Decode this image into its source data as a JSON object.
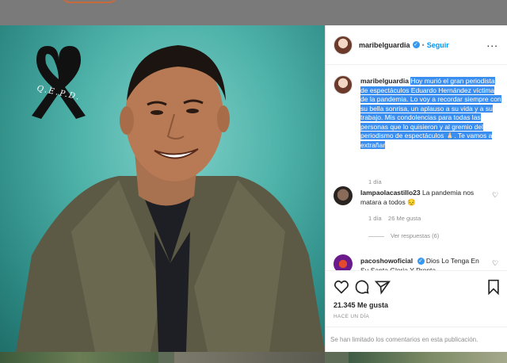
{
  "post": {
    "ribbon_text": "Q.E.P.D."
  },
  "header": {
    "username": "maribelguardia",
    "verified_icon": "check",
    "separator": "•",
    "follow_label": "Seguir",
    "more_label": "..."
  },
  "caption": {
    "username": "maribelguardia",
    "text": "Hoy murió el gran periodista de espectáculos Eduardo Hernández víctima de la pandemia. Lo voy a recordar siempre con su bella sonrisa, un aplauso a su vida y a su trabajo. Mis condolencias para todas las personas que lo quisieron y al gremio del periodismo de espectáculos 🙏🏻. Te vamos a extrañar",
    "time": "1 día"
  },
  "comments": [
    {
      "username": "lampaolacastillo23",
      "text": "La pandemia nos matara a todos 😔",
      "time": "1 día",
      "likes": "26 Me gusta",
      "replies": "Ver respuestas (6)"
    },
    {
      "username": "pacoshowoficial",
      "text": "Dios Lo Tenga En Su Santa Gloria Y Pronta"
    }
  ],
  "actions": {
    "likes": "21.345 Me gusta",
    "time_ago": "HACE UN DÍA",
    "comments_limited": "Se han limitado los comentarios en esta publicación."
  },
  "colors": {
    "highlight": "#3a8ef0",
    "link": "#0095f6",
    "verified": "#3897f0"
  }
}
